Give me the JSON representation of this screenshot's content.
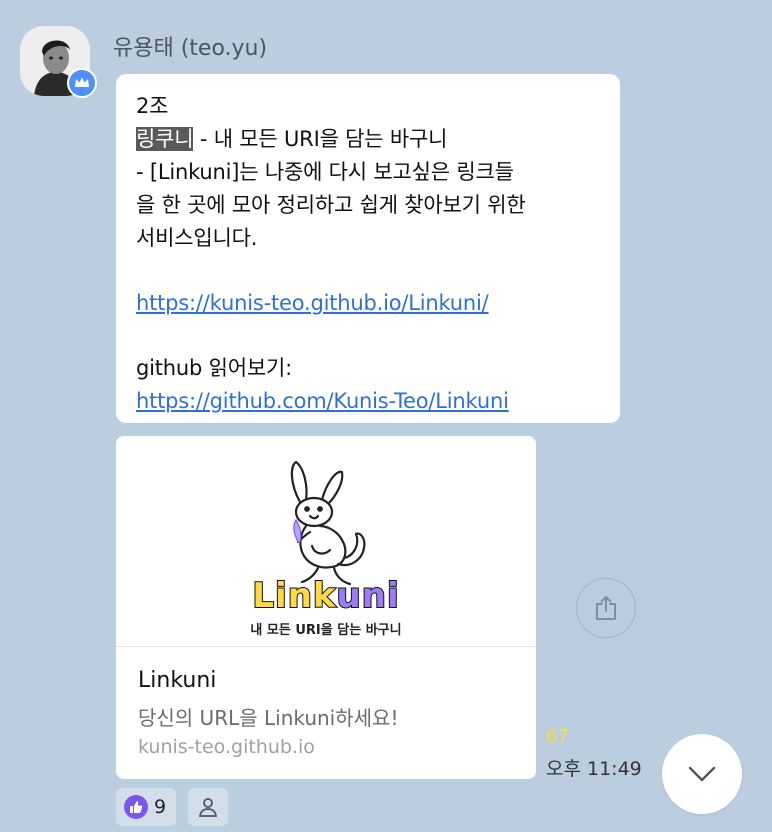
{
  "sender": {
    "name": "유용태 (teo.yu)"
  },
  "message": {
    "line1": "2조",
    "highlight": "링쿠니",
    "line2_rest": " - 내 모든 URI을 담는 바구니",
    "line3": "- [Linkuni]는 나중에 다시 보고싶은 링크들",
    "line4": "을 한 곳에 모아 정리하고 쉽게 찾아보기 위한",
    "line5": "서비스입니다.",
    "link1": "https://kunis-teo.github.io/Linkuni/",
    "line6": "github 읽어보기:",
    "link2": "https://github.com/Kunis-Teo/Linkuni"
  },
  "preview": {
    "logo_text_part1": "Link",
    "logo_text_part2": "uni",
    "logo_tagline": "내 모든 URI을 담는 바구니",
    "title": "Linkuni",
    "description": "당신의 URL을 Linkuni하세요!",
    "domain": "kunis-teo.github.io"
  },
  "meta": {
    "unread_count": "67",
    "time": "오후 11:49"
  },
  "reactions": {
    "like_count": "9"
  },
  "icons": {
    "avatar": "user-photo",
    "crown": "crown-icon",
    "share": "share-icon",
    "scroll": "chevron-down-icon",
    "like": "thumbs-up-icon",
    "add_reaction": "person-icon"
  },
  "colors": {
    "background": "#bacee0",
    "bubble": "#ffffff",
    "link": "#2f6fd6",
    "unread": "#f5e23b",
    "reaction_bg": "#d2dfeb",
    "like": "#7b56e8",
    "logo_yellow": "#ffd84a",
    "logo_purple": "#9b7cf6"
  }
}
